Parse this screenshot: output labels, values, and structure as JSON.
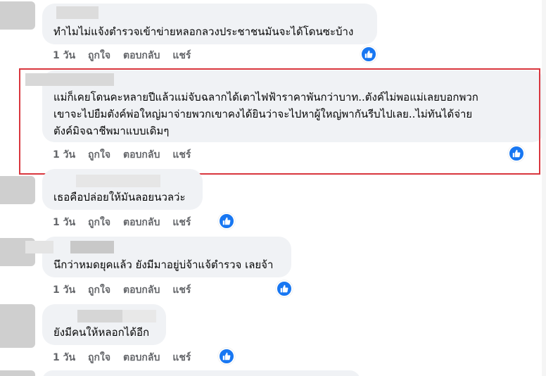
{
  "comments": [
    {
      "text_lines": [
        "ทำไมไม่แจ้งตำรวจเข้าข่ายหลอกลวงประชาชนมันจะได้โดนซะบ้าง"
      ],
      "time": "1 วัน",
      "like": "ถูกใจ",
      "reply": "ตอบกลับ",
      "share": "แชร์"
    },
    {
      "text_lines": [
        "แม่ก็เคยโดนคะหลายปีแล้วแม่จับฉลากได้เตาไฟฟ้าราคาพันกว่าบาท..ตังค์ไม่พอแม่เลยบอกพวก",
        "เขาจะไปยืมตังค์พ่อใหญ่มาจ่ายพวกเขาคงได้ยินว่าจะไปหาผู้ใหญ่พากันรีบไปเลย..ไม่ทันได้จ่าย",
        "ตังค์มิจฉาชีพมาแบบเดิมๆ"
      ],
      "time": "1 วัน",
      "like": "ถูกใจ",
      "reply": "ตอบกลับ",
      "share": "แชร์"
    },
    {
      "text_lines": [
        "เธอคือปล่อยให้มันลอยนวลว่ะ"
      ],
      "time": "1 วัน",
      "like": "ถูกใจ",
      "reply": "ตอบกลับ",
      "share": "แชร์"
    },
    {
      "text_lines": [
        "นึกว่าหมดยุคแล้ว ยังมีมาอยู่บ่จ้าแจ้ตำรวจ เลยจ้า"
      ],
      "time": "1 วัน",
      "like": "ถูกใจ",
      "reply": "ตอบกลับ",
      "share": "แชร์"
    },
    {
      "text_lines": [
        "ยังมีคนให้หลอกได้อีก"
      ],
      "time": "1 วัน",
      "like": "ถูกใจ",
      "reply": "ตอบกลับ",
      "share": "แชร์"
    }
  ],
  "colors": {
    "bubble_bg": "#f0f2f5",
    "like_blue": "#1877f2",
    "highlight_red": "#d9363e",
    "action_gray": "#65676b"
  },
  "icons": {
    "reaction": "thumbs-up-icon"
  }
}
